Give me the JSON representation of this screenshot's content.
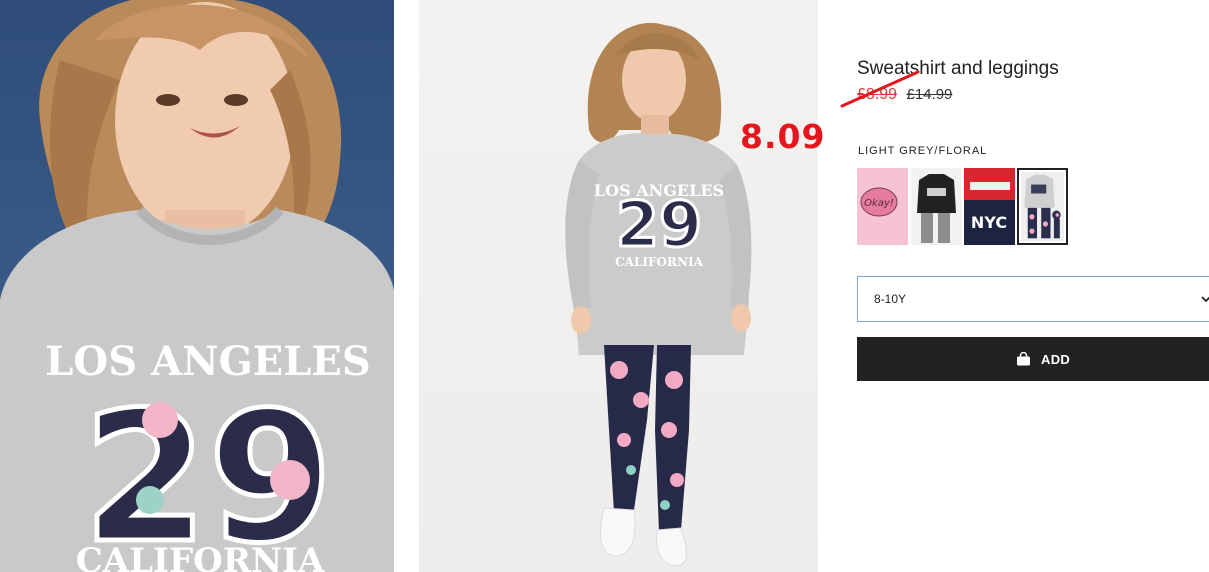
{
  "product": {
    "title": "Sweatshirt and leggings",
    "sale_price": "£8.99",
    "original_price": "£14.99",
    "color_label": "LIGHT GREY/FLORAL"
  },
  "overlay": {
    "handwritten_price": "8.09",
    "color": "#e3171d"
  },
  "photos": [
    {
      "print_top": "LOS ANGELES",
      "print_number": "29",
      "print_bottom": "CALIFORNIA"
    },
    {
      "print_top": "LOS ANGELES",
      "print_number": "29",
      "print_bottom": "CALIFORNIA"
    }
  ],
  "swatches": [
    {
      "name": "pink-okay-variant",
      "text": "Okay!",
      "selected": false
    },
    {
      "name": "black-tee-variant",
      "text": "",
      "selected": false
    },
    {
      "name": "red-nyc-variant",
      "text": "NYC",
      "selected": false
    },
    {
      "name": "grey-floral-variant",
      "text": "",
      "selected": true
    }
  ],
  "size_select": {
    "value": "8-10Y"
  },
  "add_button": {
    "label": "ADD"
  },
  "colors": {
    "button_bg": "#222222",
    "sale_red": "#d63a3a",
    "select_border": "#7aa6d8"
  }
}
